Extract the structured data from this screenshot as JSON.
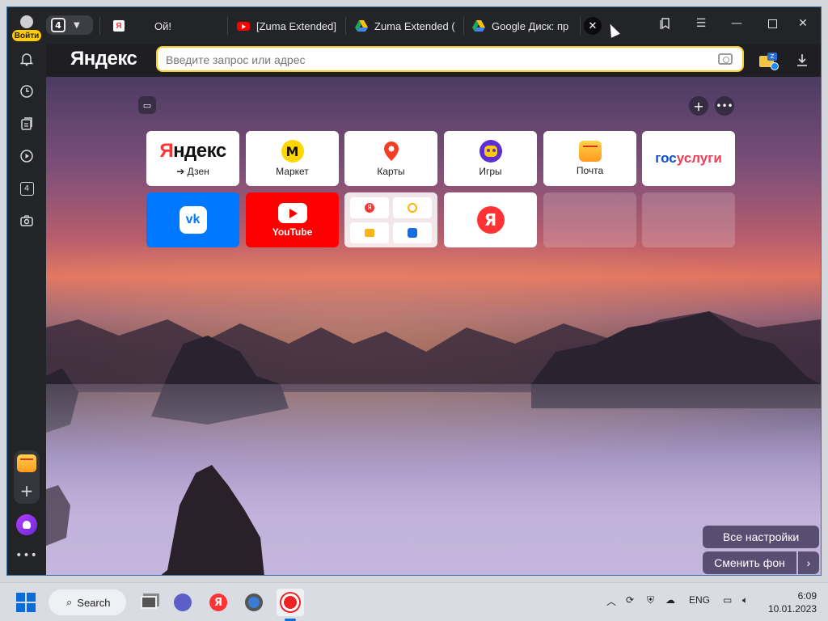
{
  "sidebar": {
    "login_label": "Войти",
    "tab_count": "4"
  },
  "tabs": [
    {
      "label": "Ой!",
      "icon": "yandex-icon"
    },
    {
      "label": "[Zuma Extended]",
      "icon": "youtube-icon"
    },
    {
      "label": "Zuma Extended (",
      "icon": "google-drive-icon"
    },
    {
      "label": "Google Диск: пр",
      "icon": "google-drive-icon"
    }
  ],
  "tab_counter": "4",
  "browser": {
    "logo": "Яндекс",
    "address_placeholder": "Введите запрос или адрес"
  },
  "tiles": [
    {
      "title": "Яндекс",
      "subtitle": "➔ Дзен"
    },
    {
      "title": "Маркет"
    },
    {
      "title": "Карты"
    },
    {
      "title": "Игры"
    },
    {
      "title": "Почта"
    },
    {
      "title": "госуслуги"
    },
    {
      "title": "VK"
    },
    {
      "title": "YouTube"
    },
    {
      "title": "yandex-services"
    },
    {
      "title": "Я"
    }
  ],
  "buttons": {
    "all_settings": "Все настройки",
    "change_background": "Сменить фон"
  },
  "taskbar": {
    "search_label": "Search",
    "language": "ENG",
    "time": "6:09",
    "date": "10.01.2023"
  },
  "colors": {
    "yandex_yellow": "#ffcc00",
    "vk_blue": "#0077ff",
    "youtube_red": "#ff0000"
  }
}
